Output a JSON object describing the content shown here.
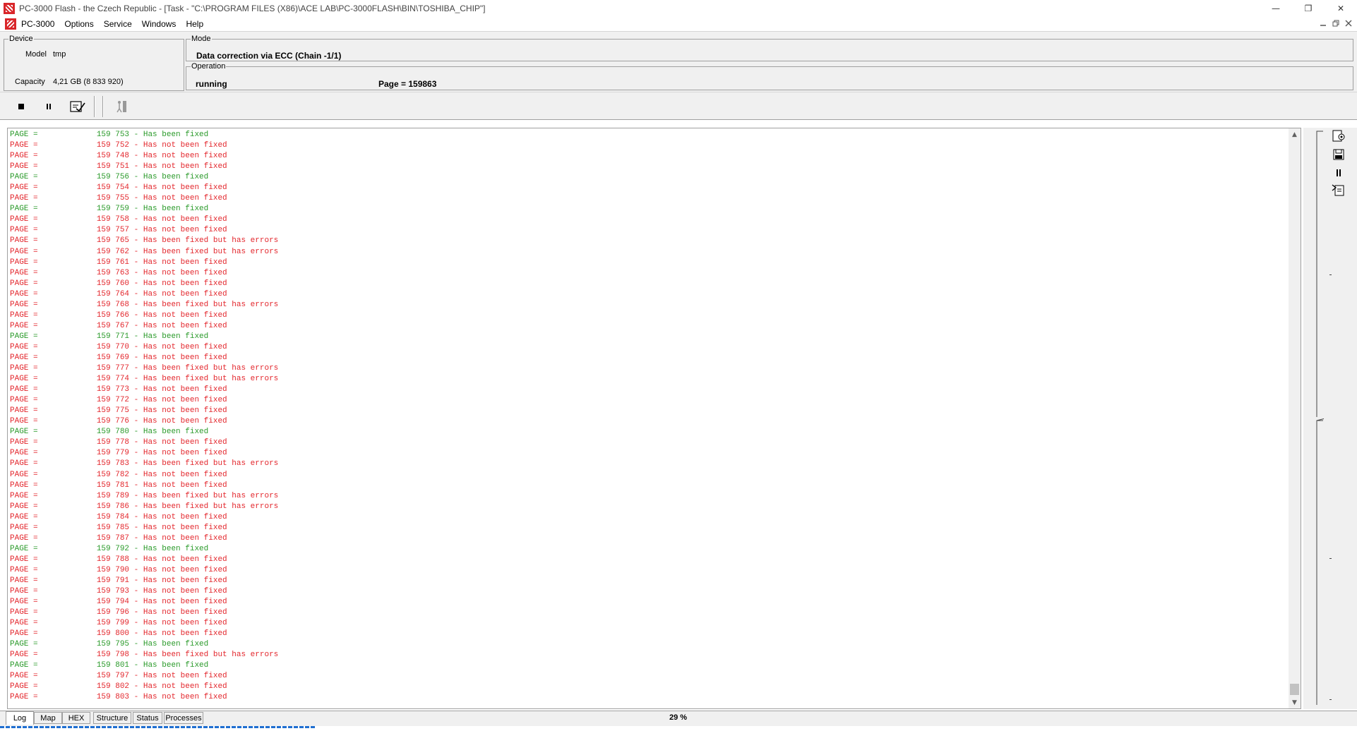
{
  "window": {
    "title": "PC-3000 Flash - the Czech Republic - [Task - \"C:\\PROGRAM FILES (X86)\\ACE LAB\\PC-3000FLASH\\BIN\\TOSHIBA_CHIP\"]",
    "minimize": "—",
    "restore": "❐",
    "close": "✕"
  },
  "menu": {
    "items": [
      "PC-3000",
      "Options",
      "Service",
      "Windows",
      "Help"
    ]
  },
  "device": {
    "legend": "Device",
    "model_label": "Model",
    "model_value": "tmp",
    "capacity_label": "Capacity",
    "capacity_value": "4,21 GB (8 833 920)"
  },
  "mode": {
    "legend": "Mode",
    "value": "Data correction via ECC (Chain -1/1)"
  },
  "operation": {
    "legend": "Operation",
    "status": "running",
    "page": "Page = 159863"
  },
  "toolbar": {
    "icons": [
      "stop-icon",
      "pause-icon",
      "check-document-icon",
      "figure-icon"
    ]
  },
  "log": {
    "prefix": "PAGE =",
    "rows": [
      {
        "page": "159 753",
        "status": "Has been fixed",
        "type": "ok"
      },
      {
        "page": "159 752",
        "status": "Has not been fixed",
        "type": "bad"
      },
      {
        "page": "159 748",
        "status": "Has not been fixed",
        "type": "bad"
      },
      {
        "page": "159 751",
        "status": "Has not been fixed",
        "type": "bad"
      },
      {
        "page": "159 756",
        "status": "Has been fixed",
        "type": "ok"
      },
      {
        "page": "159 754",
        "status": "Has not been fixed",
        "type": "bad"
      },
      {
        "page": "159 755",
        "status": "Has not been fixed",
        "type": "bad"
      },
      {
        "page": "159 759",
        "status": "Has been fixed",
        "type": "ok"
      },
      {
        "page": "159 758",
        "status": "Has not been fixed",
        "type": "bad"
      },
      {
        "page": "159 757",
        "status": "Has not been fixed",
        "type": "bad"
      },
      {
        "page": "159 765",
        "status": "Has been fixed but has errors",
        "type": "bad"
      },
      {
        "page": "159 762",
        "status": "Has been fixed but has errors",
        "type": "bad"
      },
      {
        "page": "159 761",
        "status": "Has not been fixed",
        "type": "bad"
      },
      {
        "page": "159 763",
        "status": "Has not been fixed",
        "type": "bad"
      },
      {
        "page": "159 760",
        "status": "Has not been fixed",
        "type": "bad"
      },
      {
        "page": "159 764",
        "status": "Has not been fixed",
        "type": "bad"
      },
      {
        "page": "159 768",
        "status": "Has been fixed but has errors",
        "type": "bad"
      },
      {
        "page": "159 766",
        "status": "Has not been fixed",
        "type": "bad"
      },
      {
        "page": "159 767",
        "status": "Has not been fixed",
        "type": "bad"
      },
      {
        "page": "159 771",
        "status": "Has been fixed",
        "type": "ok"
      },
      {
        "page": "159 770",
        "status": "Has not been fixed",
        "type": "bad"
      },
      {
        "page": "159 769",
        "status": "Has not been fixed",
        "type": "bad"
      },
      {
        "page": "159 777",
        "status": "Has been fixed but has errors",
        "type": "bad"
      },
      {
        "page": "159 774",
        "status": "Has been fixed but has errors",
        "type": "bad"
      },
      {
        "page": "159 773",
        "status": "Has not been fixed",
        "type": "bad"
      },
      {
        "page": "159 772",
        "status": "Has not been fixed",
        "type": "bad"
      },
      {
        "page": "159 775",
        "status": "Has not been fixed",
        "type": "bad"
      },
      {
        "page": "159 776",
        "status": "Has not been fixed",
        "type": "bad"
      },
      {
        "page": "159 780",
        "status": "Has been fixed",
        "type": "ok"
      },
      {
        "page": "159 778",
        "status": "Has not been fixed",
        "type": "bad"
      },
      {
        "page": "159 779",
        "status": "Has not been fixed",
        "type": "bad"
      },
      {
        "page": "159 783",
        "status": "Has been fixed but has errors",
        "type": "bad"
      },
      {
        "page": "159 782",
        "status": "Has not been fixed",
        "type": "bad"
      },
      {
        "page": "159 781",
        "status": "Has not been fixed",
        "type": "bad"
      },
      {
        "page": "159 789",
        "status": "Has been fixed but has errors",
        "type": "bad"
      },
      {
        "page": "159 786",
        "status": "Has been fixed but has errors",
        "type": "bad"
      },
      {
        "page": "159 784",
        "status": "Has not been fixed",
        "type": "bad"
      },
      {
        "page": "159 785",
        "status": "Has not been fixed",
        "type": "bad"
      },
      {
        "page": "159 787",
        "status": "Has not been fixed",
        "type": "bad"
      },
      {
        "page": "159 792",
        "status": "Has been fixed",
        "type": "ok"
      },
      {
        "page": "159 788",
        "status": "Has not been fixed",
        "type": "bad"
      },
      {
        "page": "159 790",
        "status": "Has not been fixed",
        "type": "bad"
      },
      {
        "page": "159 791",
        "status": "Has not been fixed",
        "type": "bad"
      },
      {
        "page": "159 793",
        "status": "Has not been fixed",
        "type": "bad"
      },
      {
        "page": "159 794",
        "status": "Has not been fixed",
        "type": "bad"
      },
      {
        "page": "159 796",
        "status": "Has not been fixed",
        "type": "bad"
      },
      {
        "page": "159 799",
        "status": "Has not been fixed",
        "type": "bad"
      },
      {
        "page": "159 800",
        "status": "Has not been fixed",
        "type": "bad"
      },
      {
        "page": "159 795",
        "status": "Has been fixed",
        "type": "ok"
      },
      {
        "page": "159 798",
        "status": "Has been fixed but has errors",
        "type": "bad"
      },
      {
        "page": "159 801",
        "status": "Has been fixed",
        "type": "ok"
      },
      {
        "page": "159 797",
        "status": "Has not been fixed",
        "type": "bad"
      },
      {
        "page": "159 802",
        "status": "Has not been fixed",
        "type": "bad"
      },
      {
        "page": "159 803",
        "status": "Has not been fixed",
        "type": "bad"
      }
    ]
  },
  "tabs": {
    "items": [
      "Log",
      "Map",
      "HEX",
      "Structure",
      "Status",
      "Processes"
    ],
    "active": "Log"
  },
  "progress": {
    "text": "29 %",
    "value": 0.29
  },
  "colors": {
    "fixed": "#2a9a2a",
    "not_fixed": "#e3262c",
    "progress": "#1f6fd1"
  }
}
